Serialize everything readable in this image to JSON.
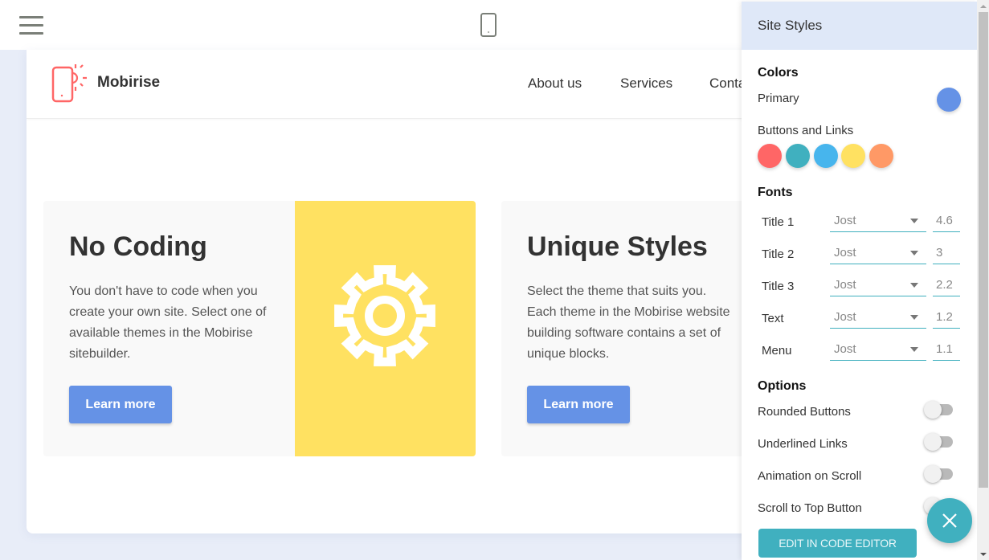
{
  "topbar": {
    "menu_icon": "hamburger-menu-icon",
    "device_icon": "mobile-device-icon"
  },
  "site": {
    "brand": "Mobirise",
    "logo_icon": "mobile-sun-logo-icon",
    "nav": [
      "About us",
      "Services",
      "Conta"
    ],
    "cards": [
      {
        "title": "No Coding",
        "text": "You don't have to code when you create your own site. Select one of available themes in the Mobirise sitebuilder.",
        "button": "Learn more",
        "media_icon": "gear-icon",
        "media_color": "#ffe161"
      },
      {
        "title": "Unique Styles",
        "text": "Select the theme that suits you. Each theme in the Mobirise website building software contains a set of unique blocks.",
        "button": "Learn more"
      }
    ],
    "button_color": "#6592e6"
  },
  "panel": {
    "title": "Site Styles",
    "colors": {
      "heading": "Colors",
      "primary_label": "Primary",
      "primary_color": "#6592e6",
      "buttons_label": "Buttons and Links",
      "swatches": [
        "#ff6666",
        "#40b0bf",
        "#47b5ed",
        "#ffe161",
        "#ff9966"
      ]
    },
    "fonts": {
      "heading": "Fonts",
      "rows": [
        {
          "label": "Title 1",
          "font": "Jost",
          "size": "4.6"
        },
        {
          "label": "Title 2",
          "font": "Jost",
          "size": "3"
        },
        {
          "label": "Title 3",
          "font": "Jost",
          "size": "2.2"
        },
        {
          "label": "Text",
          "font": "Jost",
          "size": "1.2"
        },
        {
          "label": "Menu",
          "font": "Jost",
          "size": "1.1"
        }
      ]
    },
    "options": {
      "heading": "Options",
      "toggles": [
        {
          "label": "Rounded Buttons",
          "on": false
        },
        {
          "label": "Underlined Links",
          "on": false
        },
        {
          "label": "Animation on Scroll",
          "on": false
        },
        {
          "label": "Scroll to Top Button",
          "on": false
        }
      ]
    },
    "code_button": "EDIT IN CODE EDITOR",
    "accent": "#40b0bf",
    "close_icon": "close-icon"
  }
}
